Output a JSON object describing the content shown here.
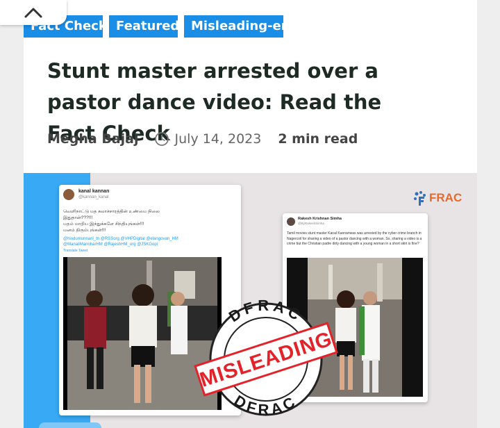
{
  "tags": [
    "Fact Check",
    "Featured",
    "Misleading-en"
  ],
  "article": {
    "title": "Stunt master arrested over a pastor dance video: Read the Fact Check",
    "author": "Megha Bajaj",
    "date": "July 14, 2023",
    "read_time": "2 min read"
  },
  "image": {
    "brand": "FRAC",
    "stamp_top": "DFRAC",
    "stamp_middle": "MISLEADING",
    "stamp_bottom": "DFRAC",
    "tweet_left": {
      "name": "kanal kannan",
      "handle": "@kannan_kanal",
      "text_lines": [
        "வெளிநாட்டு மத கலாச்சாரத்தின் உண்மை நிலை",
        "இதுதான்???!!!",
        "மதம் மாறிய இந்துக்களே சிந்தியுங்கள்!!!",
        "மனம் திரும்புங்கள்!!!"
      ],
      "mentions": [
        "@hindumunnani_tn @RSSorg @VHPDigital @elangovan_HM",
        "@ManaliManoharHM @RajeshHM_org @JSKGopi"
      ],
      "translate": "Translate Tweet"
    },
    "tweet_right": {
      "name": "Rakesh Krishnan Simha",
      "handle": "@ByRakeshSimha",
      "text": "Tamil movies stunt master Kanal Kannanwas was arrested by the cyber crime branch in Nagercoil for sharing a video of a pastor dancing with a woman. So, sharing a video is a crime but the Christian padre dirty dancing with a young woman in a short skirt is fine?"
    }
  },
  "colors": {
    "tag_bg": "#1a8de6",
    "title": "#1e2b25",
    "stamp_red": "#e3222a",
    "brand_orange": "#e86a2a",
    "band_blue": "#38a9f4"
  },
  "icons": {
    "scroll_up": "chevron-up-icon",
    "date": "clock-icon"
  }
}
